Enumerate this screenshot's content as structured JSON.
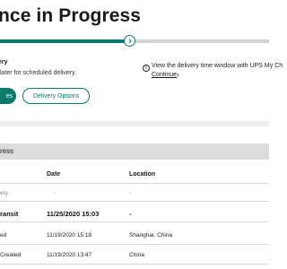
{
  "header": {
    "title": "nce in Progress"
  },
  "progress": {
    "fraction": 0.47
  },
  "delivery": {
    "title": "ery",
    "subtitle": "later for scheduled delivery.",
    "info_text": "View the delivery time window with UPS My Ch",
    "continue_label": "Continue"
  },
  "buttons": {
    "primary_label": "es",
    "delivery_options_label": "Delivery Options"
  },
  "section": {
    "title": "ress"
  },
  "table": {
    "headers": [
      "Date",
      "Location"
    ],
    "rows": [
      {
        "status": "ery",
        "date": "-",
        "location": "-"
      },
      {
        "status": "ransit",
        "date": "11/25/2020  15:03",
        "location": "-"
      },
      {
        "status": "ed",
        "date": "11/19/2020  15:18",
        "location": "Shanghai, China"
      },
      {
        "status": " Created",
        "date": "11/19/2020  13:47",
        "location": "China"
      }
    ]
  },
  "colors": {
    "accent": "#0b7a6b",
    "track": "#d3d3d3",
    "section_bar": "#dcdcdc"
  },
  "icons": {
    "step_chevron": "chevron-right-icon",
    "info": "info-icon",
    "continue_chevron": "chevron-right-icon"
  }
}
